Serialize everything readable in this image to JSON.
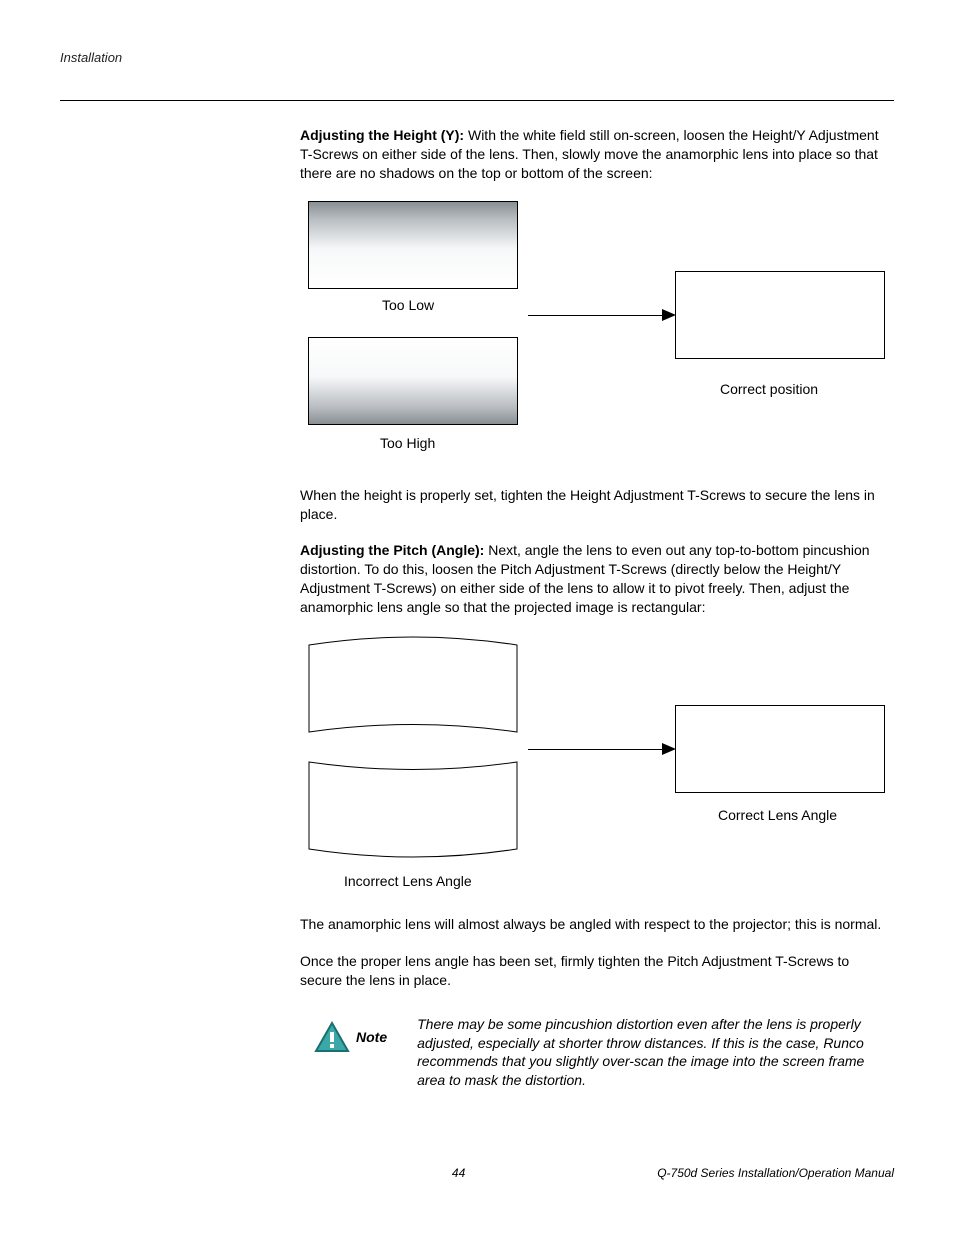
{
  "header": {
    "section": "Installation"
  },
  "content": {
    "height_heading": "Adjusting the Height (Y): ",
    "height_body": "With the white field still on-screen, loosen the Height/Y Adjustment T-Screws on either side of the lens. Then, slowly move the anamorphic lens into place so that there are no shadows on the top or bottom of the screen:",
    "diag1": {
      "too_low": "Too Low",
      "too_high": "Too High",
      "correct": "Correct position"
    },
    "height_closing": "When the height is properly set, tighten the Height Adjustment T-Screws to secure the lens in place.",
    "pitch_heading": "Adjusting the Pitch (Angle): ",
    "pitch_body": "Next, angle the lens to even out any top-to-bottom pincushion distortion. To do this, loosen the Pitch Adjustment T-Screws (directly below the Height/Y Adjustment T-Screws) on either side of the lens to allow it to pivot freely. Then, adjust the anamorphic lens angle so that the projected image is rectangular:",
    "diag2": {
      "incorrect": "Incorrect Lens Angle",
      "correct": "Correct Lens Angle"
    },
    "pitch_closing1": "The anamorphic lens will almost always be angled with respect to the projector; this is normal.",
    "pitch_closing2": "Once the proper lens angle has been set, firmly tighten the Pitch Adjustment T-Screws to secure the lens in place.",
    "note_label": "Note",
    "note_text": "There may be some pincushion distortion even after the lens is properly adjusted, especially at shorter throw distances. If this is the case, Runco recommends that you slightly over-scan the image into the screen frame area to mask the distortion."
  },
  "footer": {
    "page": "44",
    "manual": "Q-750d Series Installation/Operation Manual"
  }
}
